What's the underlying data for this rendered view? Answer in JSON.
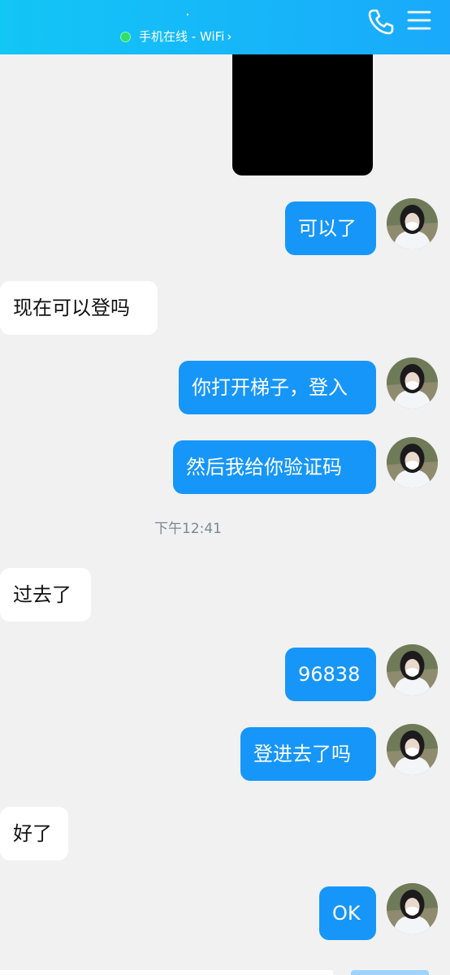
{
  "header": {
    "title": "·",
    "status": "手机在线 - WiFi",
    "status_arrow": "›",
    "call_icon": "phone-icon",
    "menu_icon": "menu-icon"
  },
  "messages": [
    {
      "side": "out",
      "text": "可以了"
    },
    {
      "side": "in",
      "text": "现在可以登吗"
    },
    {
      "side": "out",
      "text": "你打开梯子，登入"
    },
    {
      "side": "out",
      "text": "然后我给你验证码"
    },
    {
      "side": "in",
      "text": "过去了"
    },
    {
      "side": "out",
      "text": "96838"
    },
    {
      "side": "out",
      "text": "登进去了吗"
    },
    {
      "side": "in",
      "text": "好了"
    },
    {
      "side": "out",
      "text": "OK"
    }
  ],
  "timestamp": "下午12:41",
  "colors": {
    "header_start": "#12c6f6",
    "header_end": "#1aa9fb",
    "bubble_out": "#1796f9",
    "bubble_in": "#ffffff",
    "background": "#f1f1f1",
    "online_dot": "#2de06a"
  }
}
